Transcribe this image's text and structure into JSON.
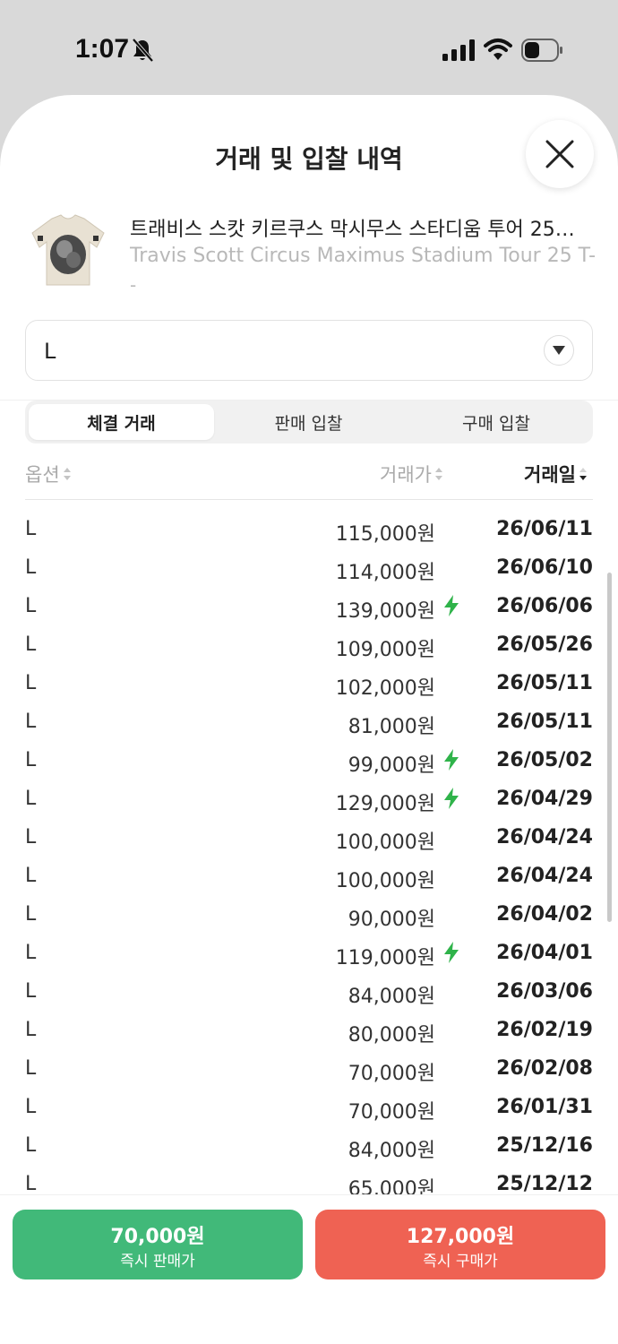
{
  "status_bar": {
    "time": "1:07"
  },
  "sheet": {
    "title": "거래 및 입찰 내역"
  },
  "product": {
    "name_ko": "트래비스 스캇 키르쿠스 막시무스 스타디움 투어 25…",
    "name_en": "Travis Scott Circus Maximus Stadium Tour 25 T-...",
    "extra": "-"
  },
  "size_select": {
    "value": "L"
  },
  "tabs": [
    {
      "label": "체결 거래",
      "active": true
    },
    {
      "label": "판매 입찰",
      "active": false
    },
    {
      "label": "구매 입찰",
      "active": false
    }
  ],
  "table": {
    "headers": {
      "option": "옵션",
      "price": "거래가",
      "date": "거래일"
    },
    "rows": [
      {
        "option": "L",
        "price": "115,000원",
        "date": "26/06/11",
        "fast": false
      },
      {
        "option": "L",
        "price": "114,000원",
        "date": "26/06/10",
        "fast": false
      },
      {
        "option": "L",
        "price": "139,000원",
        "date": "26/06/06",
        "fast": true
      },
      {
        "option": "L",
        "price": "109,000원",
        "date": "26/05/26",
        "fast": false
      },
      {
        "option": "L",
        "price": "102,000원",
        "date": "26/05/11",
        "fast": false
      },
      {
        "option": "L",
        "price": "81,000원",
        "date": "26/05/11",
        "fast": false
      },
      {
        "option": "L",
        "price": "99,000원",
        "date": "26/05/02",
        "fast": true
      },
      {
        "option": "L",
        "price": "129,000원",
        "date": "26/04/29",
        "fast": true
      },
      {
        "option": "L",
        "price": "100,000원",
        "date": "26/04/24",
        "fast": false
      },
      {
        "option": "L",
        "price": "100,000원",
        "date": "26/04/24",
        "fast": false
      },
      {
        "option": "L",
        "price": "90,000원",
        "date": "26/04/02",
        "fast": false
      },
      {
        "option": "L",
        "price": "119,000원",
        "date": "26/04/01",
        "fast": true
      },
      {
        "option": "L",
        "price": "84,000원",
        "date": "26/03/06",
        "fast": false
      },
      {
        "option": "L",
        "price": "80,000원",
        "date": "26/02/19",
        "fast": false
      },
      {
        "option": "L",
        "price": "70,000원",
        "date": "26/02/08",
        "fast": false
      },
      {
        "option": "L",
        "price": "70,000원",
        "date": "26/01/31",
        "fast": false
      },
      {
        "option": "L",
        "price": "84,000원",
        "date": "25/12/16",
        "fast": false
      },
      {
        "option": "L",
        "price": "65,000원",
        "date": "25/12/12",
        "fast": false
      }
    ]
  },
  "actions": {
    "sell": {
      "price": "70,000원",
      "label": "즉시 판매가",
      "color": "#41b979"
    },
    "buy": {
      "price": "127,000원",
      "label": "즉시 구매가",
      "color": "#ef6253"
    }
  },
  "icons": {
    "bell": "bell-slash-icon",
    "signal": "cellular-signal-icon",
    "wifi": "wifi-icon",
    "battery": "battery-icon",
    "close": "close-icon",
    "dropdown": "triangle-down-icon",
    "sort": "sort-icon",
    "fast": "lightning-bolt-icon"
  },
  "colors": {
    "bolt": "#2fb34a"
  }
}
